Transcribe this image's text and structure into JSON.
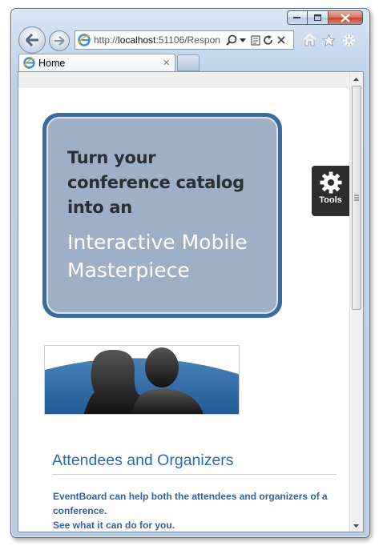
{
  "browser": {
    "url_prefix": "http://",
    "url_host": "localhost",
    "url_rest": ":51106/Respon",
    "tab_title": "Home",
    "tab_close": "×"
  },
  "promo": {
    "line1": "Turn your conference catalog into an",
    "line2": "Interactive Mobile Masterpiece"
  },
  "tools": {
    "label": "Tools"
  },
  "section": {
    "heading": "Attendees and Organizers",
    "text1": "EventBoard can help both the attendees and organizers of a conference.",
    "text2": "See what it can do for you."
  },
  "colors": {
    "promo_bg": "#9db0c6",
    "promo_border": "#3b6aa0",
    "heading": "#2b6aac",
    "body_text": "#35629a"
  }
}
